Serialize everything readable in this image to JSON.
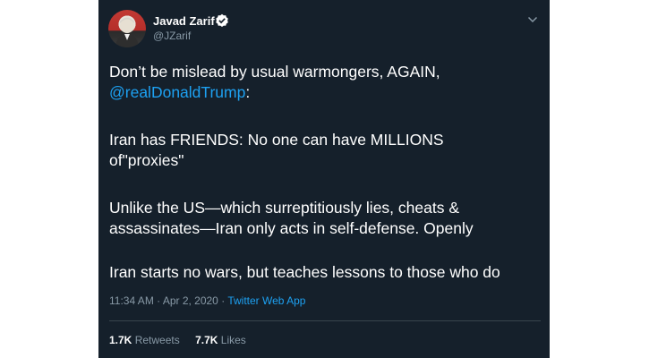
{
  "tweet": {
    "author_name": "Javad Zarif",
    "author_handle": "@JZarif",
    "lines": [
      {
        "text": "Don’t be mislead by usual warmongers, AGAIN,"
      },
      {
        "mention": "@realDonaldTrump",
        "suffix": ":"
      },
      {
        "text": "Iran has FRIENDS: No one can have MILLIONS"
      },
      {
        "text": "of\"proxies\""
      },
      {
        "text": "Unlike the US—which surreptitiously lies, cheats &"
      },
      {
        "text": "assassinates—Iran only acts in self-defense. Openly"
      },
      {
        "text": "Iran starts no wars, but teaches lessons to those who do"
      }
    ],
    "time": "11:34 AM · Apr 2, 2020 · ",
    "source_app": "Twitter Web App",
    "retweets_count": "1.7K",
    "retweets_label": "Retweets",
    "likes_count": "7.7K",
    "likes_label": "Likes"
  },
  "colors": {
    "background": "#15202b",
    "text": "#ffffff",
    "secondary": "#8899a6",
    "accent": "#1da1f2"
  },
  "icons": [
    "verified-badge-icon",
    "chevron-down-icon"
  ]
}
